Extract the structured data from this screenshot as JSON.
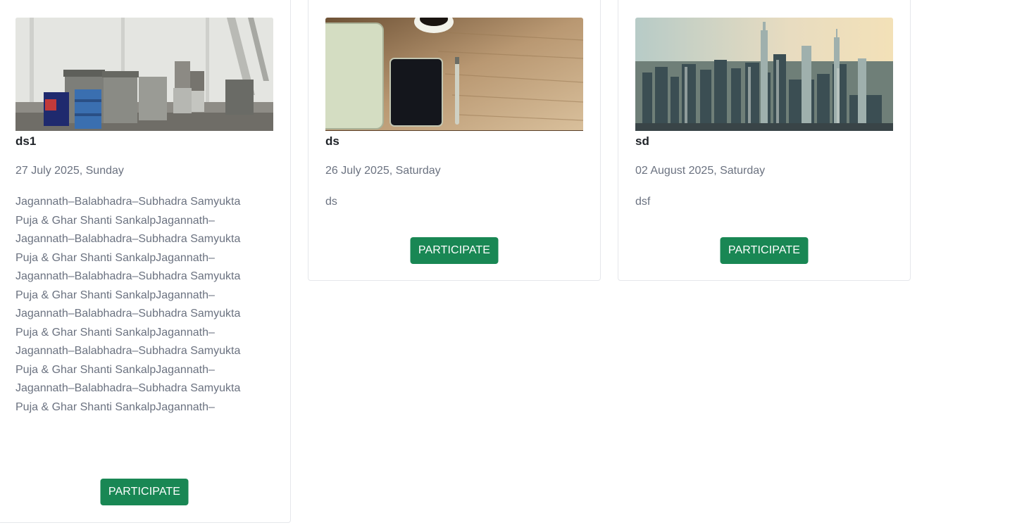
{
  "events": [
    {
      "title": "ds1",
      "date": "27 July 2025, Sunday",
      "description": "Jagannath–Balabhadra–Subhadra Samyukta Puja & Ghar Shanti SankalpJagannath–Jagannath–Balabhadra–Subhadra Samyukta Puja & Ghar Shanti SankalpJagannath–Jagannath–Balabhadra–Subhadra Samyukta Puja & Ghar Shanti SankalpJagannath–Jagannath–Balabhadra–Subhadra Samyukta Puja & Ghar Shanti SankalpJagannath–Jagannath–Balabhadra–Subhadra Samyukta Puja & Ghar Shanti SankalpJagannath–Jagannath–Balabhadra–Subhadra Samyukta Puja & Ghar Shanti SankalpJagannath–",
      "button_label": "PARTICIPATE",
      "image": "trash-bins-photo"
    },
    {
      "title": "ds",
      "date": "26 July 2025, Saturday",
      "description": "ds",
      "button_label": "PARTICIPATE",
      "image": "desk-tablet-photo"
    },
    {
      "title": "sd",
      "date": "02 August 2025, Saturday",
      "description": "dsf",
      "button_label": "PARTICIPATE",
      "image": "city-skyline-photo"
    }
  ],
  "colors": {
    "button": "#198754",
    "title": "#1f2328",
    "muted_text": "#6b7280",
    "card_border": "#e5e7eb"
  }
}
